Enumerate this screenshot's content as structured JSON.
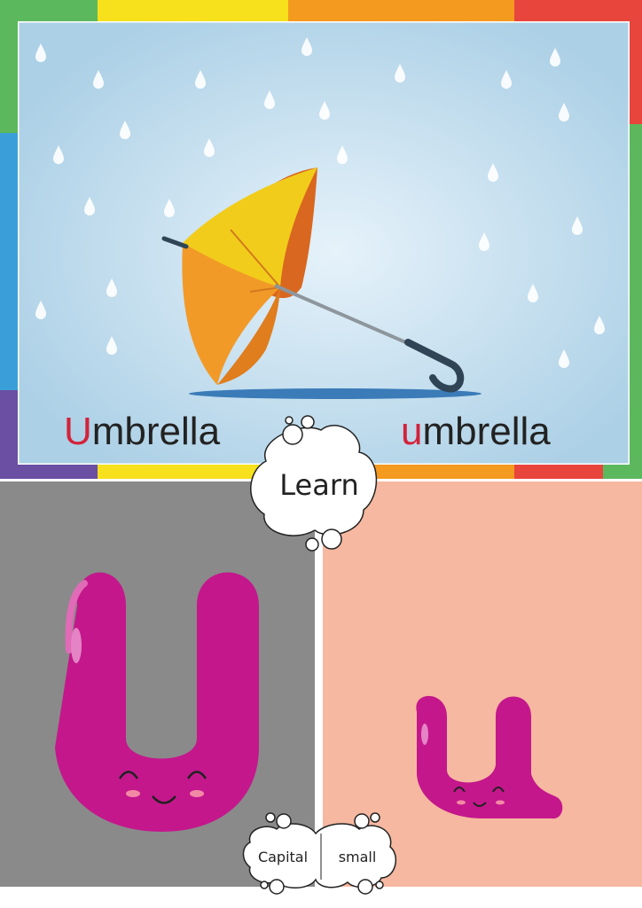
{
  "card": {
    "words": {
      "capital_first": "U",
      "capital_rest": "mbrella",
      "small_first": "u",
      "small_rest": "mbrella"
    },
    "learn_label": "Learn",
    "capital_label": "Capital",
    "small_label": "small"
  },
  "colors": {
    "sky": "#b4d6ea",
    "letter": "#c4178c",
    "panel_left": "#8a8a8a",
    "panel_right": "#f6b8a0",
    "first_letter": "#d4223a"
  },
  "icons": [
    "umbrella-icon",
    "raindrop-icon",
    "capital-u-character-icon",
    "small-u-character-icon",
    "cloud-bubble-icon"
  ]
}
